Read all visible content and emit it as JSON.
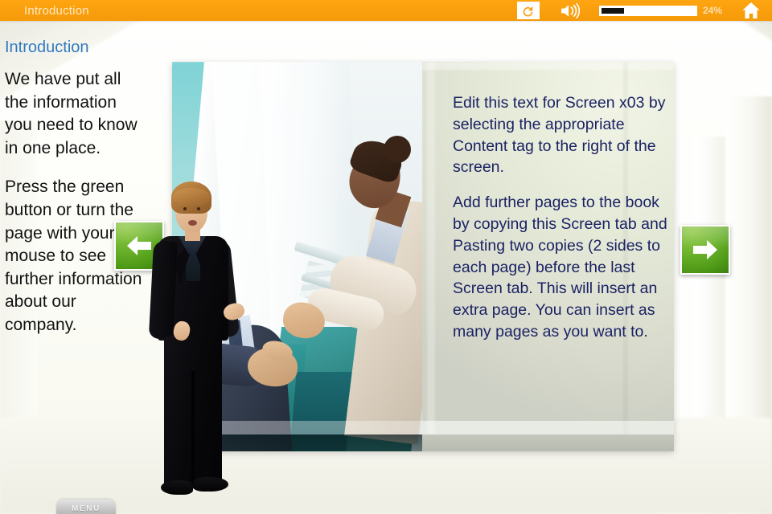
{
  "topbar": {
    "title": "Introduction",
    "replay_icon": "replay-circular-arrow-icon",
    "volume_icon": "speaker-volume-icon",
    "home_icon": "home-icon",
    "progress_percent": 24,
    "progress_label": "24%",
    "accent_color": "#f99f0d",
    "title_color": "#fde8c4"
  },
  "page": {
    "heading": "Introduction",
    "heading_color": "#2f78bd",
    "left_paragraphs": [
      "We have put all the information you need to know in one place.",
      "Press the green button or turn the page with your mouse to see further information about our company."
    ]
  },
  "content": {
    "photo_alt": "business-handshake-photo",
    "right_text_color": "#1b2263",
    "right_paragraphs": [
      "Edit this text for Screen x03 by selecting the appropriate Content tag to the right of the screen.",
      "Add further pages to the book by copying this Screen tab and Pasting two copies (2 sides to each page) before the last Screen tab.  This will insert an extra page. You can insert as many pages as you want to."
    ]
  },
  "nav": {
    "prev_icon": "arrow-left-icon",
    "next_icon": "arrow-right-icon",
    "button_color": "#5aa81c"
  },
  "presenter": {
    "name": "presenter-avatar"
  },
  "footer": {
    "menu_label": "MENU"
  }
}
